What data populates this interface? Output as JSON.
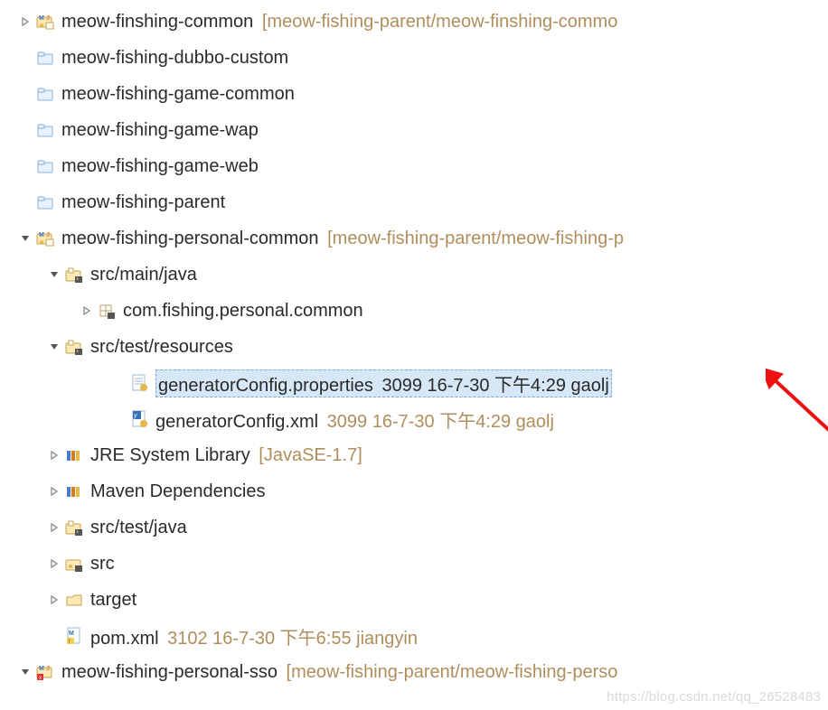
{
  "watermark": "https://blog.csdn.net/qq_26528483",
  "tree": [
    {
      "indent": 0,
      "arrow": "right",
      "icon": "mj-project",
      "name": "meow-finshing-common",
      "meta": "[meow-fishing-parent/meow-finshing-commo"
    },
    {
      "indent": 0,
      "arrow": "",
      "icon": "folder-closed",
      "name": "meow-fishing-dubbo-custom",
      "meta": ""
    },
    {
      "indent": 0,
      "arrow": "",
      "icon": "folder-closed",
      "name": "meow-fishing-game-common",
      "meta": ""
    },
    {
      "indent": 0,
      "arrow": "",
      "icon": "folder-closed",
      "name": "meow-fishing-game-wap",
      "meta": ""
    },
    {
      "indent": 0,
      "arrow": "",
      "icon": "folder-closed",
      "name": "meow-fishing-game-web",
      "meta": ""
    },
    {
      "indent": 0,
      "arrow": "",
      "icon": "folder-closed",
      "name": "meow-fishing-parent",
      "meta": ""
    },
    {
      "indent": 0,
      "arrow": "down",
      "icon": "mj-project",
      "name": "meow-fishing-personal-common",
      "meta": "[meow-fishing-parent/meow-fishing-p"
    },
    {
      "indent": 1,
      "arrow": "down",
      "icon": "src-folder",
      "name": "src/main/java",
      "meta": ""
    },
    {
      "indent": 2,
      "arrow": "right",
      "icon": "package",
      "name": "com.fishing.personal.common",
      "meta": ""
    },
    {
      "indent": 1,
      "arrow": "down",
      "icon": "src-folder",
      "name": "src/test/resources",
      "meta": ""
    },
    {
      "indent": 3,
      "arrow": "",
      "icon": "prop-file",
      "name": "generatorConfig.properties",
      "meta": "3099  16-7-30 下午4:29  gaolj",
      "selected": true
    },
    {
      "indent": 3,
      "arrow": "",
      "icon": "xml-file",
      "name": "generatorConfig.xml",
      "meta": "3099  16-7-30 下午4:29  gaolj"
    },
    {
      "indent": 1,
      "arrow": "right",
      "icon": "library",
      "name": "JRE System Library",
      "meta": "[JavaSE-1.7]"
    },
    {
      "indent": 1,
      "arrow": "right",
      "icon": "library",
      "name": "Maven Dependencies",
      "meta": ""
    },
    {
      "indent": 1,
      "arrow": "right",
      "icon": "src-folder",
      "name": "src/test/java",
      "meta": ""
    },
    {
      "indent": 1,
      "arrow": "right",
      "icon": "src-folder-plain",
      "name": "src",
      "meta": ""
    },
    {
      "indent": 1,
      "arrow": "right",
      "icon": "folder-open",
      "name": "target",
      "meta": ""
    },
    {
      "indent": 1,
      "arrow": "",
      "icon": "pom-file",
      "name": "pom.xml",
      "meta": "3102  16-7-30 下午6:55  jiangyin"
    },
    {
      "indent": 0,
      "arrow": "down",
      "icon": "mj-project-err",
      "name": "meow-fishing-personal-sso",
      "meta": "[meow-fishing-parent/meow-fishing-perso"
    }
  ]
}
